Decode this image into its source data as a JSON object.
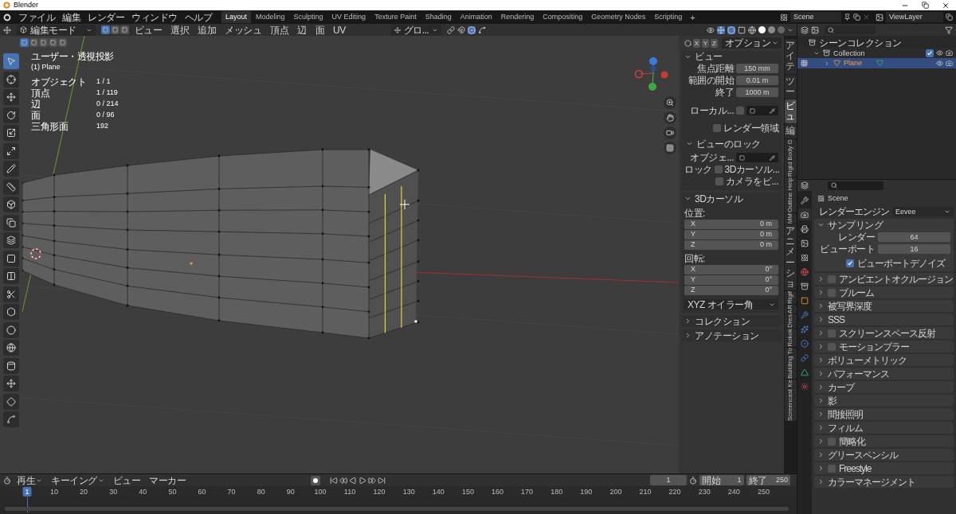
{
  "window": {
    "title": "Blender"
  },
  "menu": [
    "ファイル",
    "編集",
    "レンダー",
    "ウィンドウ",
    "ヘルプ"
  ],
  "workspaces": [
    {
      "label": "Layout",
      "selected": true
    },
    {
      "label": "Modeling",
      "selected": false
    },
    {
      "label": "Sculpting",
      "selected": false
    },
    {
      "label": "UV Editing",
      "selected": false
    },
    {
      "label": "Texture Paint",
      "selected": false
    },
    {
      "label": "Shading",
      "selected": false
    },
    {
      "label": "Animation",
      "selected": false
    },
    {
      "label": "Rendering",
      "selected": false
    },
    {
      "label": "Compositing",
      "selected": false
    },
    {
      "label": "Geometry Nodes",
      "selected": false
    },
    {
      "label": "Scripting",
      "selected": false
    }
  ],
  "add_workspace": "+",
  "scene": "Scene",
  "view_layer": "ViewLayer",
  "header": {
    "mode": "編集モード",
    "select_modes": [
      {
        "selected": true
      },
      {
        "selected": false
      },
      {
        "selected": false
      }
    ],
    "menus": [
      "ビュー",
      "選択",
      "追加",
      "メッシュ",
      "頂点",
      "辺",
      "面",
      "UV"
    ],
    "orientation": "グロ..."
  },
  "selection_ops": [
    {
      "selected": true
    },
    {
      "selected": false
    },
    {
      "selected": false
    },
    {
      "selected": false
    },
    {
      "selected": false
    }
  ],
  "overlay": {
    "view_name": "ユーザー・透視投影",
    "object_name": "(1) Plane",
    "stats": [
      {
        "label": "オブジェクト",
        "value": "1 / 1"
      },
      {
        "label": "頂点",
        "value": "1 / 119"
      },
      {
        "label": "辺",
        "value": "0 / 214"
      },
      {
        "label": "面",
        "value": "0 / 96"
      },
      {
        "label": "三角形面",
        "value": "192"
      }
    ]
  },
  "tools": [
    {
      "selected": true
    },
    {
      "selected": false
    },
    {
      "selected": false
    },
    {
      "selected": false
    },
    {
      "selected": false
    },
    {
      "selected": false
    },
    {
      "selected": false
    },
    {
      "selected": false
    },
    {
      "selected": false
    },
    {
      "selected": false
    },
    {
      "selected": false
    },
    {
      "selected": false
    },
    {
      "selected": false
    },
    {
      "selected": false
    },
    {
      "selected": false
    },
    {
      "selected": false
    },
    {
      "selected": false
    },
    {
      "selected": false
    },
    {
      "selected": false
    },
    {
      "selected": false
    },
    {
      "selected": false
    }
  ],
  "sidebar": {
    "axes": [
      "X",
      "Y",
      "Z"
    ],
    "options": "オプション",
    "view": {
      "title": "ビュー",
      "expanded": true,
      "fields": [
        {
          "label": "焦点距離",
          "value": "150 mm"
        },
        {
          "label": "範囲の開始",
          "value": "0.01 m"
        },
        {
          "label": "終了",
          "value": "1000 m"
        }
      ],
      "local": {
        "label": "ローカル...",
        "checked": false
      },
      "render_region": {
        "label": "レンダー領域",
        "checked": false
      },
      "lock": {
        "title": "ビューのロック",
        "expanded": true,
        "object_label": "オブジェ...",
        "lock_label": "ロック",
        "options": [
          {
            "label": "3Dカーソル...",
            "checked": false
          },
          {
            "label": "カメラをビ...",
            "checked": false
          }
        ]
      }
    },
    "cursor": {
      "title": "3Dカーソル",
      "expanded": true,
      "location_label": "位置:",
      "location": [
        {
          "axis": "X",
          "value": "0 m"
        },
        {
          "axis": "Y",
          "value": "0 m"
        },
        {
          "axis": "Z",
          "value": "0 m"
        }
      ],
      "rotation_label": "回転:",
      "rotation": [
        {
          "axis": "X",
          "value": "0°"
        },
        {
          "axis": "Y",
          "value": "0°"
        },
        {
          "axis": "Z",
          "value": "0°"
        }
      ],
      "rotation_mode": "XYZ オイラー角"
    },
    "panels": [
      {
        "title": "コレクション",
        "expanded": false
      },
      {
        "title": "アノテーション",
        "expanded": false
      }
    ]
  },
  "sidebar_tabs": [
    {
      "label": "アイテ",
      "kind": "cjk",
      "selected": false
    },
    {
      "label": "ツー",
      "kind": "cjk",
      "selected": false
    },
    {
      "label": "ビュ",
      "kind": "cjk",
      "selected": true
    },
    {
      "label": "編",
      "kind": "cjk",
      "selected": false
    },
    {
      "label": "Rigid Body G",
      "kind": "latin",
      "selected": false
    },
    {
      "label": "Outline Help",
      "kind": "latin",
      "selected": false
    },
    {
      "label": "MM",
      "kind": "latin",
      "selected": false
    },
    {
      "label": "アニメーショ",
      "kind": "cjk",
      "selected": false
    },
    {
      "label": "Rigif",
      "kind": "latin",
      "selected": false
    },
    {
      "label": "AR",
      "kind": "latin",
      "selected": false
    },
    {
      "label": "Dres",
      "kind": "latin",
      "selected": false
    },
    {
      "label": "Rokok",
      "kind": "latin",
      "selected": false
    },
    {
      "label": "Building To",
      "kind": "latin",
      "selected": false
    },
    {
      "label": "Screencast Ke",
      "kind": "latin",
      "selected": false
    }
  ],
  "outliner": {
    "scene_collection": "シーンコレクション",
    "collection": {
      "label": "Collection",
      "checked": true
    },
    "objects": [
      {
        "label": "Plane",
        "selected": true
      }
    ]
  },
  "properties": {
    "tabs": [
      {
        "selected": false
      },
      {
        "selected": true
      },
      {
        "selected": false
      },
      {
        "selected": false
      },
      {
        "selected": false
      },
      {
        "selected": false
      },
      {
        "selected": false
      },
      {
        "selected": false
      },
      {
        "selected": false
      },
      {
        "selected": false
      },
      {
        "selected": false
      },
      {
        "selected": false
      },
      {
        "selected": false
      },
      {
        "selected": false
      }
    ],
    "context": "Scene",
    "engine_label": "レンダーエンジン",
    "engine": "Eevee",
    "sampling": {
      "title": "サンプリング",
      "expanded": true,
      "fields": [
        {
          "label": "レンダー",
          "value": "64"
        },
        {
          "label": "ビューポート",
          "value": "16"
        }
      ],
      "denoise": {
        "label": "ビューポートデノイズ",
        "checked": true
      }
    },
    "panels": [
      {
        "title": "アンビエントオクルージョン",
        "kind": "toggle",
        "checked": false,
        "expanded": false
      },
      {
        "title": "ブルーム",
        "kind": "toggle",
        "checked": false,
        "expanded": false
      },
      {
        "title": "被写界深度",
        "kind": "plain",
        "expanded": false
      },
      {
        "title": "SSS",
        "kind": "plain",
        "expanded": false
      },
      {
        "title": "スクリーンスペース反射",
        "kind": "toggle",
        "checked": false,
        "expanded": false
      },
      {
        "title": "モーションブラー",
        "kind": "toggle",
        "checked": false,
        "expanded": false
      },
      {
        "title": "ボリューメトリック",
        "kind": "plain",
        "expanded": false
      },
      {
        "title": "パフォーマンス",
        "kind": "plain",
        "expanded": false
      },
      {
        "title": "カーブ",
        "kind": "plain",
        "expanded": false
      },
      {
        "title": "影",
        "kind": "plain",
        "expanded": false
      },
      {
        "title": "間接照明",
        "kind": "plain",
        "expanded": false
      },
      {
        "title": "フィルム",
        "kind": "plain",
        "expanded": false
      },
      {
        "title": "簡略化",
        "kind": "toggle",
        "checked": false,
        "expanded": false
      },
      {
        "title": "グリースペンシル",
        "kind": "plain",
        "expanded": false
      },
      {
        "title": "Freestyle",
        "kind": "toggle",
        "checked": false,
        "expanded": false
      },
      {
        "title": "カラーマネージメント",
        "kind": "plain",
        "expanded": false
      }
    ]
  },
  "timeline": {
    "menus": [
      "再生",
      "キーイング",
      "ビュー",
      "マーカー"
    ],
    "current_frame": "1",
    "start_label": "開始",
    "start": "1",
    "end_label": "終了",
    "end": "250",
    "ruler": [
      {
        "label": "1",
        "selected": true
      },
      {
        "label": "10",
        "selected": false
      },
      {
        "label": "20",
        "selected": false
      },
      {
        "label": "30",
        "selected": false
      },
      {
        "label": "40",
        "selected": false
      },
      {
        "label": "50",
        "selected": false
      },
      {
        "label": "60",
        "selected": false
      },
      {
        "label": "70",
        "selected": false
      },
      {
        "label": "80",
        "selected": false
      },
      {
        "label": "90",
        "selected": false
      },
      {
        "label": "100",
        "selected": false
      },
      {
        "label": "110",
        "selected": false
      },
      {
        "label": "120",
        "selected": false
      },
      {
        "label": "130",
        "selected": false
      },
      {
        "label": "140",
        "selected": false
      },
      {
        "label": "150",
        "selected": false
      },
      {
        "label": "160",
        "selected": false
      },
      {
        "label": "170",
        "selected": false
      },
      {
        "label": "180",
        "selected": false
      },
      {
        "label": "190",
        "selected": false
      },
      {
        "label": "200",
        "selected": false
      },
      {
        "label": "210",
        "selected": false
      },
      {
        "label": "220",
        "selected": false
      },
      {
        "label": "230",
        "selected": false
      },
      {
        "label": "240",
        "selected": false
      },
      {
        "label": "250",
        "selected": false
      }
    ]
  }
}
